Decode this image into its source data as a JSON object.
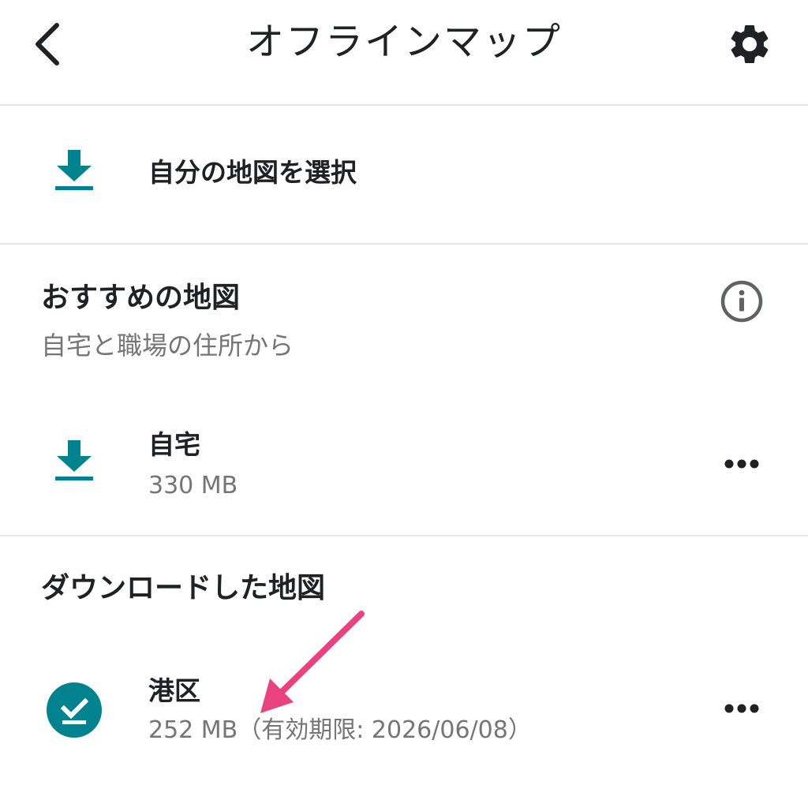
{
  "header": {
    "title": "オフラインマップ",
    "back_icon": "chevron-left-icon",
    "settings_icon": "gear-icon"
  },
  "select_maps": {
    "label": "自分の地図を選択",
    "icon": "download-icon"
  },
  "recommended": {
    "title": "おすすめの地図",
    "subtitle": "自宅と職場の住所から",
    "info_icon": "info-icon",
    "items": [
      {
        "name": "自宅",
        "size": "330 MB",
        "icon": "download-icon",
        "menu_icon": "more-horizontal-icon"
      }
    ]
  },
  "downloaded": {
    "title": "ダウンロードした地図",
    "items": [
      {
        "name": "港区",
        "size": "252 MB（有効期限: 2026/06/08）",
        "icon": "downloaded-check-icon",
        "menu_icon": "more-horizontal-icon"
      }
    ]
  },
  "colors": {
    "accent": "#00838F",
    "text_primary": "#202124",
    "text_secondary": "#757575",
    "divider": "#E6E6E6",
    "annotation_arrow": "#E8427F"
  }
}
